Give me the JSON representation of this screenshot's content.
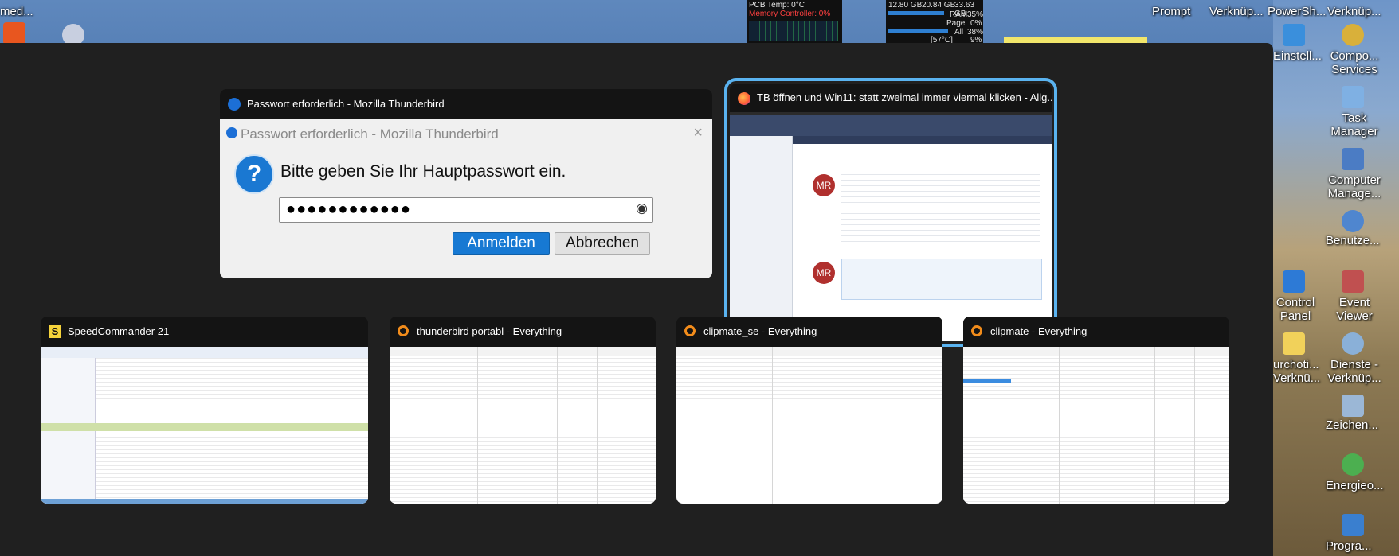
{
  "desktop": {
    "top_left_label": "med...",
    "right_icons": [
      {
        "label": "Prompt"
      },
      {
        "label": "Verknüp..."
      },
      {
        "label": "PowerSh..."
      },
      {
        "label": "Verknüp..."
      },
      {
        "label": "Einstell..."
      },
      {
        "label": "Compo... Services"
      },
      {
        "label": "Task Manager"
      },
      {
        "label": "Computer Manage..."
      },
      {
        "label": "Benutze..."
      },
      {
        "label": "Control Panel"
      },
      {
        "label": "Event Viewer"
      },
      {
        "label": "urchoti... Verknü..."
      },
      {
        "label": "Dienste - Verknüp..."
      },
      {
        "label": "Zeichen..."
      },
      {
        "label": "Energieo..."
      },
      {
        "label": "Progra..."
      }
    ],
    "widget_temp": {
      "line1": "PCB Temp: 0°C",
      "line2": "Memory Controller: 0%"
    },
    "widget_mem": {
      "line1a": "12.80 GB",
      "line1b": "20.84 GB",
      "line1c": "33.63 GB",
      "ram_label": "RAM",
      "ram_value": "35%",
      "page_label": "Page",
      "page_value": "0%",
      "all_label": "All",
      "all_value": "38%",
      "temp": "[57°C]",
      "temp_value": "9%"
    }
  },
  "task_switcher": {
    "windows": [
      {
        "title": "Passwort erforderlich - Mozilla Thunderbird",
        "dialog": {
          "title": "Passwort erforderlich - Mozilla Thunderbird",
          "message": "Bitte geben Sie Ihr Hauptpasswort ein.",
          "password_value": "●●●●●●●●●●●●",
          "ok_label": "Anmelden",
          "cancel_label": "Abbrechen"
        }
      },
      {
        "title": "TB öffnen und Win11: statt zweimal immer viermal klicken - Allg...",
        "selected": true,
        "avatar": "MR"
      },
      {
        "title": "SpeedCommander 21"
      },
      {
        "title": "thunderbird portabl - Everything"
      },
      {
        "title": "clipmate_se - Everything"
      },
      {
        "title": "clipmate - Everything"
      }
    ]
  },
  "colors": {
    "selection": "#5ab3f0",
    "primary_button": "#1779d3",
    "overlay": "#202020"
  }
}
